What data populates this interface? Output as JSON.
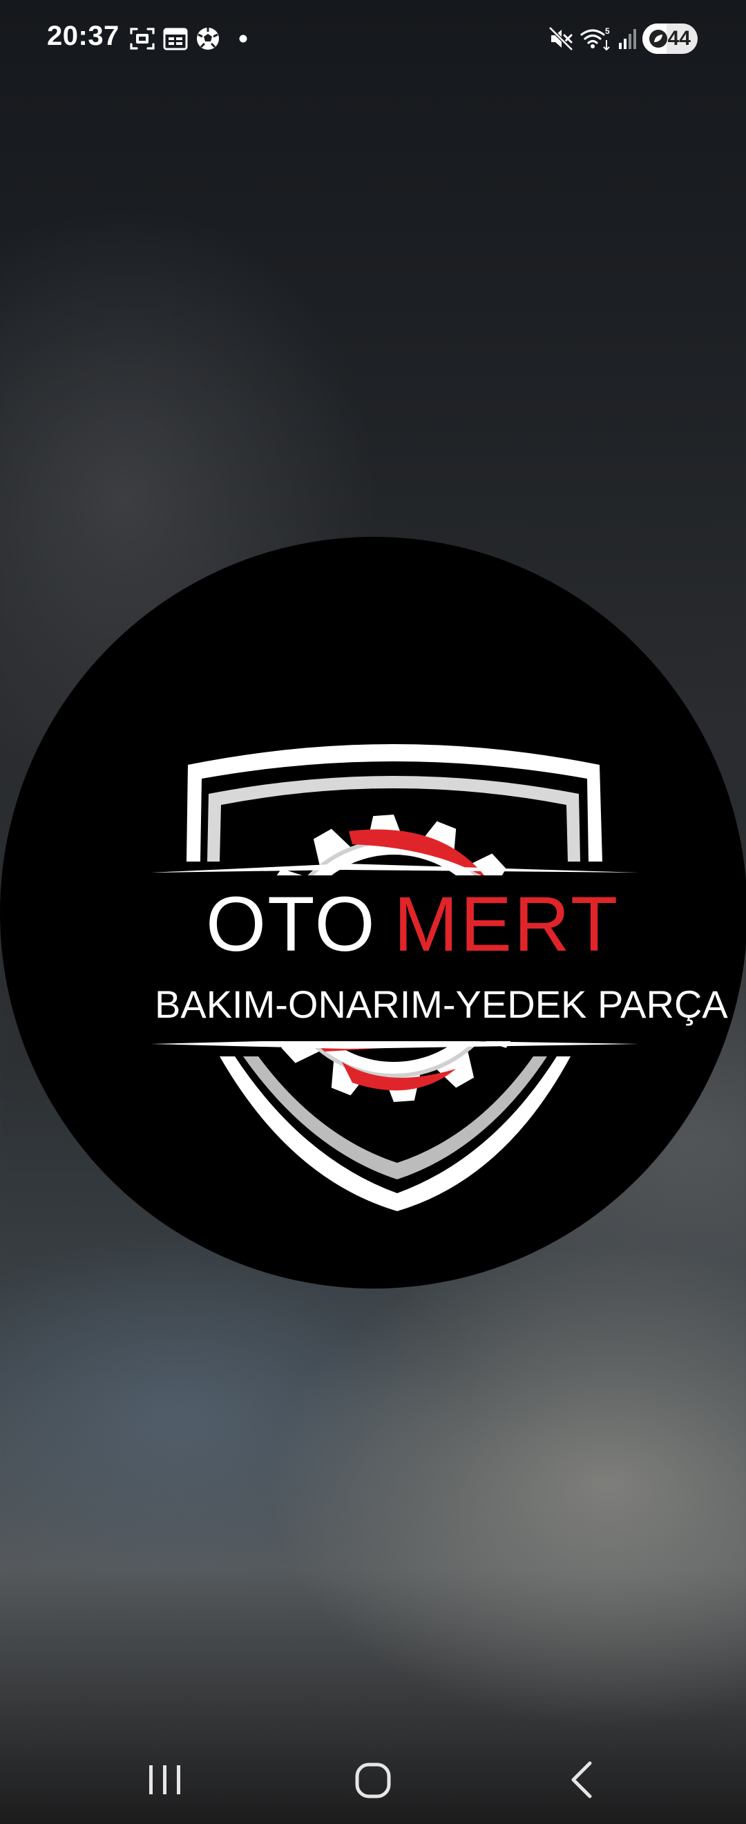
{
  "status_bar": {
    "time": "20:37",
    "left_icons": [
      "screenshot-icon",
      "calendar-icon",
      "football-icon",
      "notification-dot-icon"
    ],
    "right_icons": [
      "mute-icon",
      "wifi-5g-icon",
      "signal-icon"
    ],
    "battery_level": "44",
    "battery_fraction": 0.44
  },
  "splash": {
    "brand_first": "OTO",
    "brand_second": "MERT",
    "tagline": "BAKIM-ONARIM-YEDEK PARÇA",
    "colors": {
      "accent": "#e0252a",
      "text": "#ffffff",
      "circle": "#000000"
    }
  },
  "nav_bar": {
    "buttons": [
      "recent-apps",
      "home",
      "back"
    ]
  }
}
